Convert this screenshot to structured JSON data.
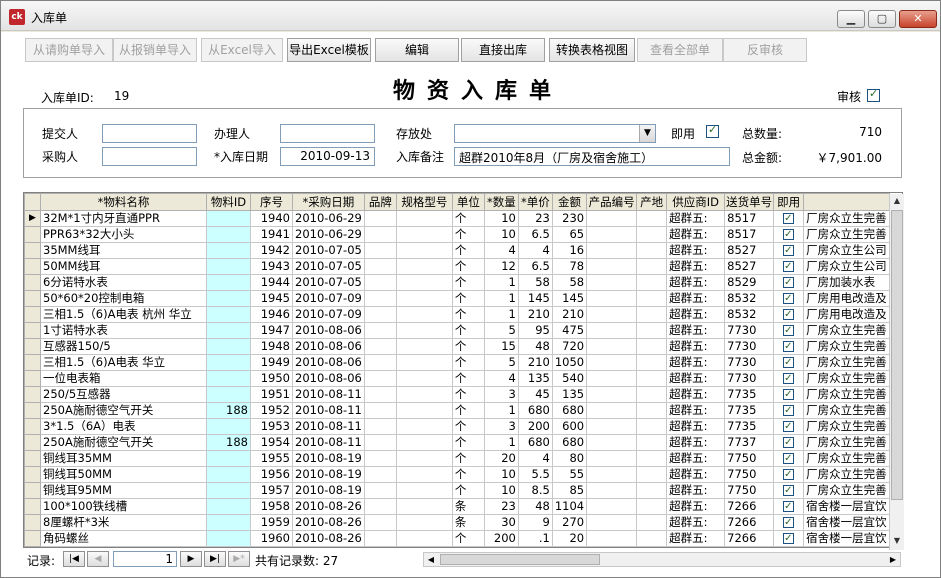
{
  "window": {
    "title": "入库单",
    "icon_text": "ck"
  },
  "toolbar": [
    {
      "label": "从请购单导入",
      "enabled": false
    },
    {
      "label": "从报销单导入",
      "enabled": false
    },
    {
      "label": "从Excel导入",
      "enabled": false
    },
    {
      "label": "导出Excel模板",
      "enabled": true
    },
    {
      "label": "编辑",
      "enabled": true
    },
    {
      "label": "直接出库",
      "enabled": true
    },
    {
      "label": "转换表格视图",
      "enabled": true
    },
    {
      "label": "查看全部单",
      "enabled": false
    },
    {
      "label": "反审核",
      "enabled": false
    }
  ],
  "header": {
    "id_label": "入库单ID:",
    "id_value": "19",
    "title": "物资入库单",
    "audit_label": "审核",
    "audit_checked": true
  },
  "form": {
    "submitter_label": "提交人",
    "submitter_value": "",
    "buyer_label": "采购人",
    "buyer_value": "",
    "handler_label": "办理人",
    "handler_value": "",
    "date_label": "*入库日期",
    "date_value": "2010-09-13",
    "location_label": "存放处",
    "location_value": "",
    "instant_label": "即用",
    "instant_checked": true,
    "note_label": "入库备注",
    "note_value": "超群2010年8月（厂房及宿舍施工）",
    "qty_label": "总数量:",
    "qty_value": "710",
    "amount_label": "总金额:",
    "amount_value": "￥7,901.00"
  },
  "grid": {
    "columns": [
      "*物料名称",
      "物料ID",
      "序号",
      "*采购日期",
      "品牌",
      "规格型号",
      "单位",
      "*数量",
      "*单价",
      "金额",
      "产品编号",
      "产地",
      "供应商ID",
      "送货单号",
      "即用",
      ""
    ],
    "rows": [
      [
        "32M*1寸内牙直通PPR",
        "",
        "1940",
        "2010-06-29",
        "",
        "",
        "个",
        "10",
        "23",
        "230",
        "",
        "",
        "超群五:",
        "8517",
        true,
        "厂房众立生完善"
      ],
      [
        "PPR63*32大小头",
        "",
        "1941",
        "2010-06-29",
        "",
        "",
        "个",
        "10",
        "6.5",
        "65",
        "",
        "",
        "超群五:",
        "8517",
        true,
        "厂房众立生完善"
      ],
      [
        "35MM线耳",
        "",
        "1942",
        "2010-07-05",
        "",
        "",
        "个",
        "4",
        "4",
        "16",
        "",
        "",
        "超群五:",
        "8527",
        true,
        "厂房众立生公司"
      ],
      [
        "50MM线耳",
        "",
        "1943",
        "2010-07-05",
        "",
        "",
        "个",
        "12",
        "6.5",
        "78",
        "",
        "",
        "超群五:",
        "8527",
        true,
        "厂房众立生公司"
      ],
      [
        "6分诺特水表",
        "",
        "1944",
        "2010-07-05",
        "",
        "",
        "个",
        "1",
        "58",
        "58",
        "",
        "",
        "超群五:",
        "8529",
        true,
        "厂房加装水表"
      ],
      [
        "50*60*20控制电箱",
        "",
        "1945",
        "2010-07-09",
        "",
        "",
        "个",
        "1",
        "145",
        "145",
        "",
        "",
        "超群五:",
        "8532",
        true,
        "厂房用电改造及"
      ],
      [
        "三相1.5（6)A电表 杭州 华立",
        "",
        "1946",
        "2010-07-09",
        "",
        "",
        "个",
        "1",
        "210",
        "210",
        "",
        "",
        "超群五:",
        "8532",
        true,
        "厂房用电改造及"
      ],
      [
        "1寸诺特水表",
        "",
        "1947",
        "2010-08-06",
        "",
        "",
        "个",
        "5",
        "95",
        "475",
        "",
        "",
        "超群五:",
        "7730",
        true,
        "厂房众立生完善"
      ],
      [
        "互感器150/5",
        "",
        "1948",
        "2010-08-06",
        "",
        "",
        "个",
        "15",
        "48",
        "720",
        "",
        "",
        "超群五:",
        "7730",
        true,
        "厂房众立生完善"
      ],
      [
        "三相1.5（6)A电表 华立",
        "",
        "1949",
        "2010-08-06",
        "",
        "",
        "个",
        "5",
        "210",
        "1050",
        "",
        "",
        "超群五:",
        "7730",
        true,
        "厂房众立生完善"
      ],
      [
        "一位电表箱",
        "",
        "1950",
        "2010-08-06",
        "",
        "",
        "个",
        "4",
        "135",
        "540",
        "",
        "",
        "超群五:",
        "7730",
        true,
        "厂房众立生完善"
      ],
      [
        "250/5互感器",
        "",
        "1951",
        "2010-08-11",
        "",
        "",
        "个",
        "3",
        "45",
        "135",
        "",
        "",
        "超群五:",
        "7735",
        true,
        "厂房众立生完善"
      ],
      [
        "250A施耐德空气开关",
        "188",
        "1952",
        "2010-08-11",
        "",
        "",
        "个",
        "1",
        "680",
        "680",
        "",
        "",
        "超群五:",
        "7735",
        true,
        "厂房众立生完善"
      ],
      [
        "3*1.5（6A）电表",
        "",
        "1953",
        "2010-08-11",
        "",
        "",
        "个",
        "3",
        "200",
        "600",
        "",
        "",
        "超群五:",
        "7735",
        true,
        "厂房众立生完善"
      ],
      [
        "250A施耐德空气开关",
        "188",
        "1954",
        "2010-08-11",
        "",
        "",
        "个",
        "1",
        "680",
        "680",
        "",
        "",
        "超群五:",
        "7737",
        true,
        "厂房众立生完善"
      ],
      [
        "铜线耳35MM",
        "",
        "1955",
        "2010-08-19",
        "",
        "",
        "个",
        "20",
        "4",
        "80",
        "",
        "",
        "超群五:",
        "7750",
        true,
        "厂房众立生完善"
      ],
      [
        "铜线耳50MM",
        "",
        "1956",
        "2010-08-19",
        "",
        "",
        "个",
        "10",
        "5.5",
        "55",
        "",
        "",
        "超群五:",
        "7750",
        true,
        "厂房众立生完善"
      ],
      [
        "铜线耳95MM",
        "",
        "1957",
        "2010-08-19",
        "",
        "",
        "个",
        "10",
        "8.5",
        "85",
        "",
        "",
        "超群五:",
        "7750",
        true,
        "厂房众立生完善"
      ],
      [
        "100*100铁线槽",
        "",
        "1958",
        "2010-08-26",
        "",
        "",
        "条",
        "23",
        "48",
        "1104",
        "",
        "",
        "超群五:",
        "7266",
        true,
        "宿舍楼一层宜饮"
      ],
      [
        "8厘螺杆*3米",
        "",
        "1959",
        "2010-08-26",
        "",
        "",
        "条",
        "30",
        "9",
        "270",
        "",
        "",
        "超群五:",
        "7266",
        true,
        "宿舍楼一层宜饮"
      ],
      [
        "角码螺丝",
        "",
        "1960",
        "2010-08-26",
        "",
        "",
        "个",
        "200",
        ".1",
        "20",
        "",
        "",
        "超群五:",
        "7266",
        true,
        "宿舍楼一层宜饮"
      ]
    ]
  },
  "navigation": {
    "record_label": "记录:",
    "current": "1",
    "total_text": "共有记录数: 27"
  }
}
